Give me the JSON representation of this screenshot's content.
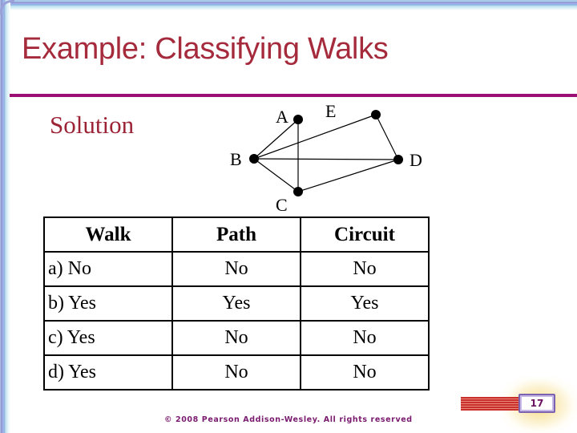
{
  "slide": {
    "title": "Example: Classifying Walks",
    "solution_label": "Solution",
    "page_number": "17",
    "footer": "© 2008 Pearson Addison-Wesley. All rights reserved"
  },
  "graph": {
    "vertices": [
      {
        "id": "A",
        "label": "A"
      },
      {
        "id": "E",
        "label": "E"
      },
      {
        "id": "B",
        "label": "B"
      },
      {
        "id": "D",
        "label": "D"
      },
      {
        "id": "C",
        "label": "C"
      }
    ],
    "edges": [
      [
        "A",
        "B"
      ],
      [
        "A",
        "C"
      ],
      [
        "B",
        "E"
      ],
      [
        "B",
        "D"
      ],
      [
        "B",
        "C"
      ],
      [
        "E",
        "D"
      ],
      [
        "C",
        "D"
      ]
    ]
  },
  "table": {
    "headers": [
      "Walk",
      "Path",
      "Circuit"
    ],
    "rows": [
      {
        "walk": "a)  No",
        "path": "No",
        "circuit": "No"
      },
      {
        "walk": "b)  Yes",
        "path": "Yes",
        "circuit": "Yes"
      },
      {
        "walk": "c)  Yes",
        "path": "No",
        "circuit": "No"
      },
      {
        "walk": "d)  Yes",
        "path": "No",
        "circuit": "No"
      }
    ]
  }
}
